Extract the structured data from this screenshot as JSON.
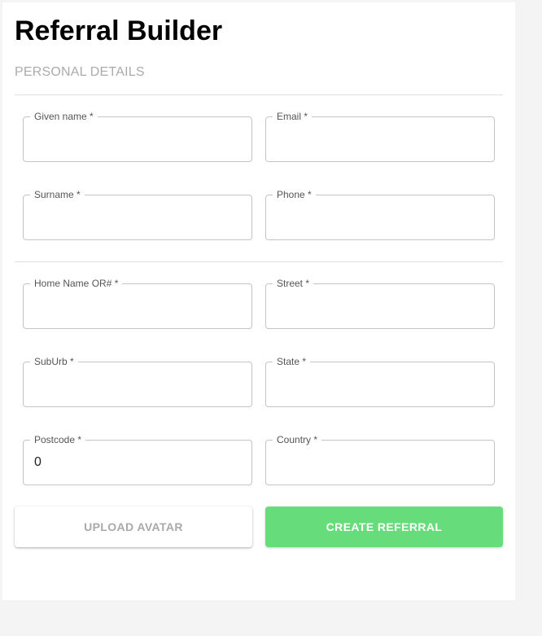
{
  "page": {
    "title": "Referral Builder",
    "section_label": "PERSONAL DETAILS"
  },
  "fields": {
    "given_name": {
      "label": "Given name *",
      "value": ""
    },
    "email": {
      "label": "Email *",
      "value": ""
    },
    "surname": {
      "label": "Surname *",
      "value": ""
    },
    "phone": {
      "label": "Phone *",
      "value": ""
    },
    "home_name": {
      "label": "Home Name OR# *",
      "value": ""
    },
    "street": {
      "label": "Street *",
      "value": ""
    },
    "suburb": {
      "label": "SubUrb *",
      "value": ""
    },
    "state": {
      "label": "State *",
      "value": ""
    },
    "postcode": {
      "label": "Postcode *",
      "value": "0"
    },
    "country": {
      "label": "Country *",
      "value": ""
    }
  },
  "actions": {
    "upload_label": "UPLOAD AVATAR",
    "create_label": "CREATE REFERRAL"
  },
  "colors": {
    "accent": "#66dc7a",
    "muted_text": "#ababab"
  }
}
